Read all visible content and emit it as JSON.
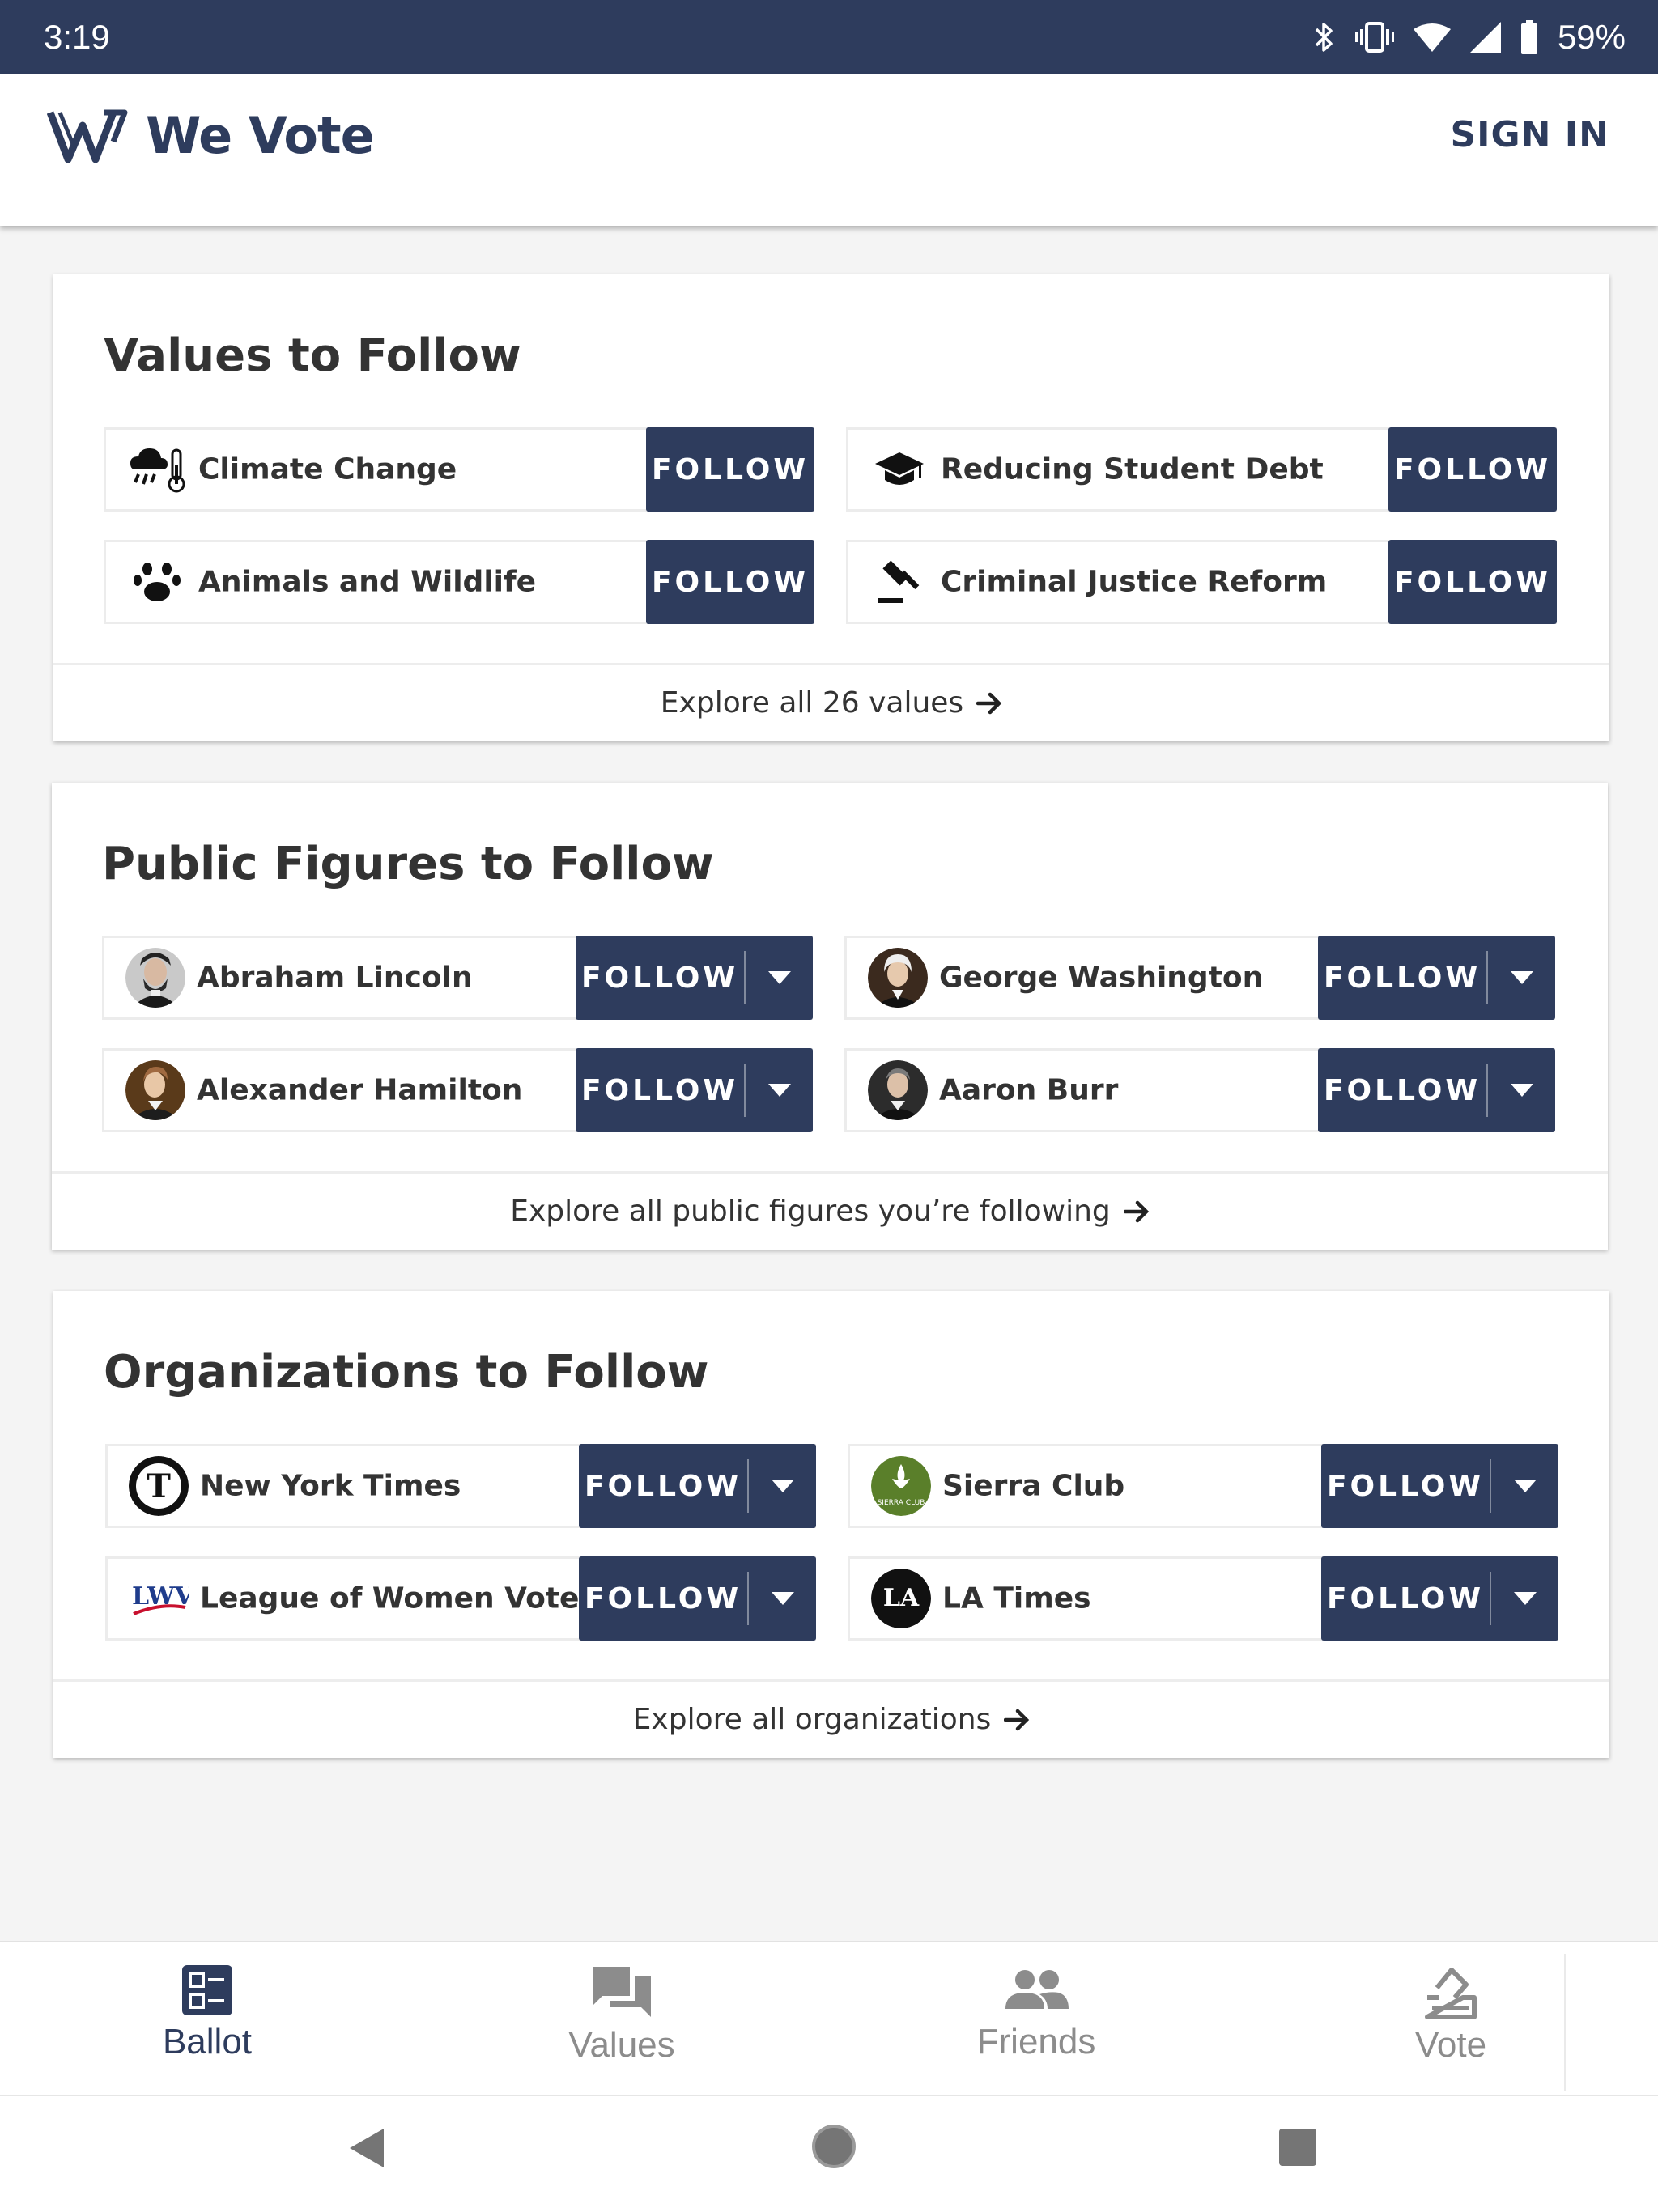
{
  "status_bar": {
    "time": "3:19",
    "battery_percent": "59%",
    "icons": [
      "bluetooth-icon",
      "vibrate-icon",
      "wifi-icon",
      "cell-signal-icon",
      "battery-icon"
    ]
  },
  "header": {
    "logo_text": "We Vote",
    "sign_in_label": "SIGN IN",
    "brand_color": "#2e3c5d"
  },
  "values_card": {
    "title": "Values to Follow",
    "items": [
      {
        "label": "Climate Change",
        "icon": "climate-icon",
        "button": "FOLLOW"
      },
      {
        "label": "Reducing Student Debt",
        "icon": "graduation-cap-icon",
        "button": "FOLLOW"
      },
      {
        "label": "Animals and Wildlife",
        "icon": "paw-icon",
        "button": "FOLLOW"
      },
      {
        "label": "Criminal Justice Reform",
        "icon": "gavel-icon",
        "button": "FOLLOW"
      }
    ],
    "footer": "Explore all 26 values"
  },
  "figures_card": {
    "title": "Public Figures to Follow",
    "items": [
      {
        "label": "Abraham Lincoln",
        "button": "FOLLOW"
      },
      {
        "label": "George Washington",
        "button": "FOLLOW"
      },
      {
        "label": "Alexander Hamilton",
        "button": "FOLLOW"
      },
      {
        "label": "Aaron Burr",
        "button": "FOLLOW"
      }
    ],
    "footer": "Explore all public figures you’re following"
  },
  "orgs_card": {
    "title": "Organizations to Follow",
    "items": [
      {
        "label": "New York Times",
        "logo_text": "T",
        "button": "FOLLOW"
      },
      {
        "label": "Sierra Club",
        "logo_text": "SIERRA CLUB",
        "button": "FOLLOW"
      },
      {
        "label": "League of Women Voters",
        "logo_text": "LWV",
        "button": "FOLLOW"
      },
      {
        "label": "LA Times",
        "logo_text": "LA",
        "button": "FOLLOW"
      }
    ],
    "footer": "Explore all organizations"
  },
  "bottom_nav": {
    "items": [
      {
        "label": "Ballot",
        "icon": "ballot-icon",
        "active": true
      },
      {
        "label": "Values",
        "icon": "values-icon",
        "active": false
      },
      {
        "label": "Friends",
        "icon": "friends-icon",
        "active": false
      },
      {
        "label": "Vote",
        "icon": "vote-icon",
        "active": false
      }
    ]
  },
  "system_nav": {
    "icons": [
      "back-icon",
      "home-icon",
      "recents-icon"
    ]
  }
}
